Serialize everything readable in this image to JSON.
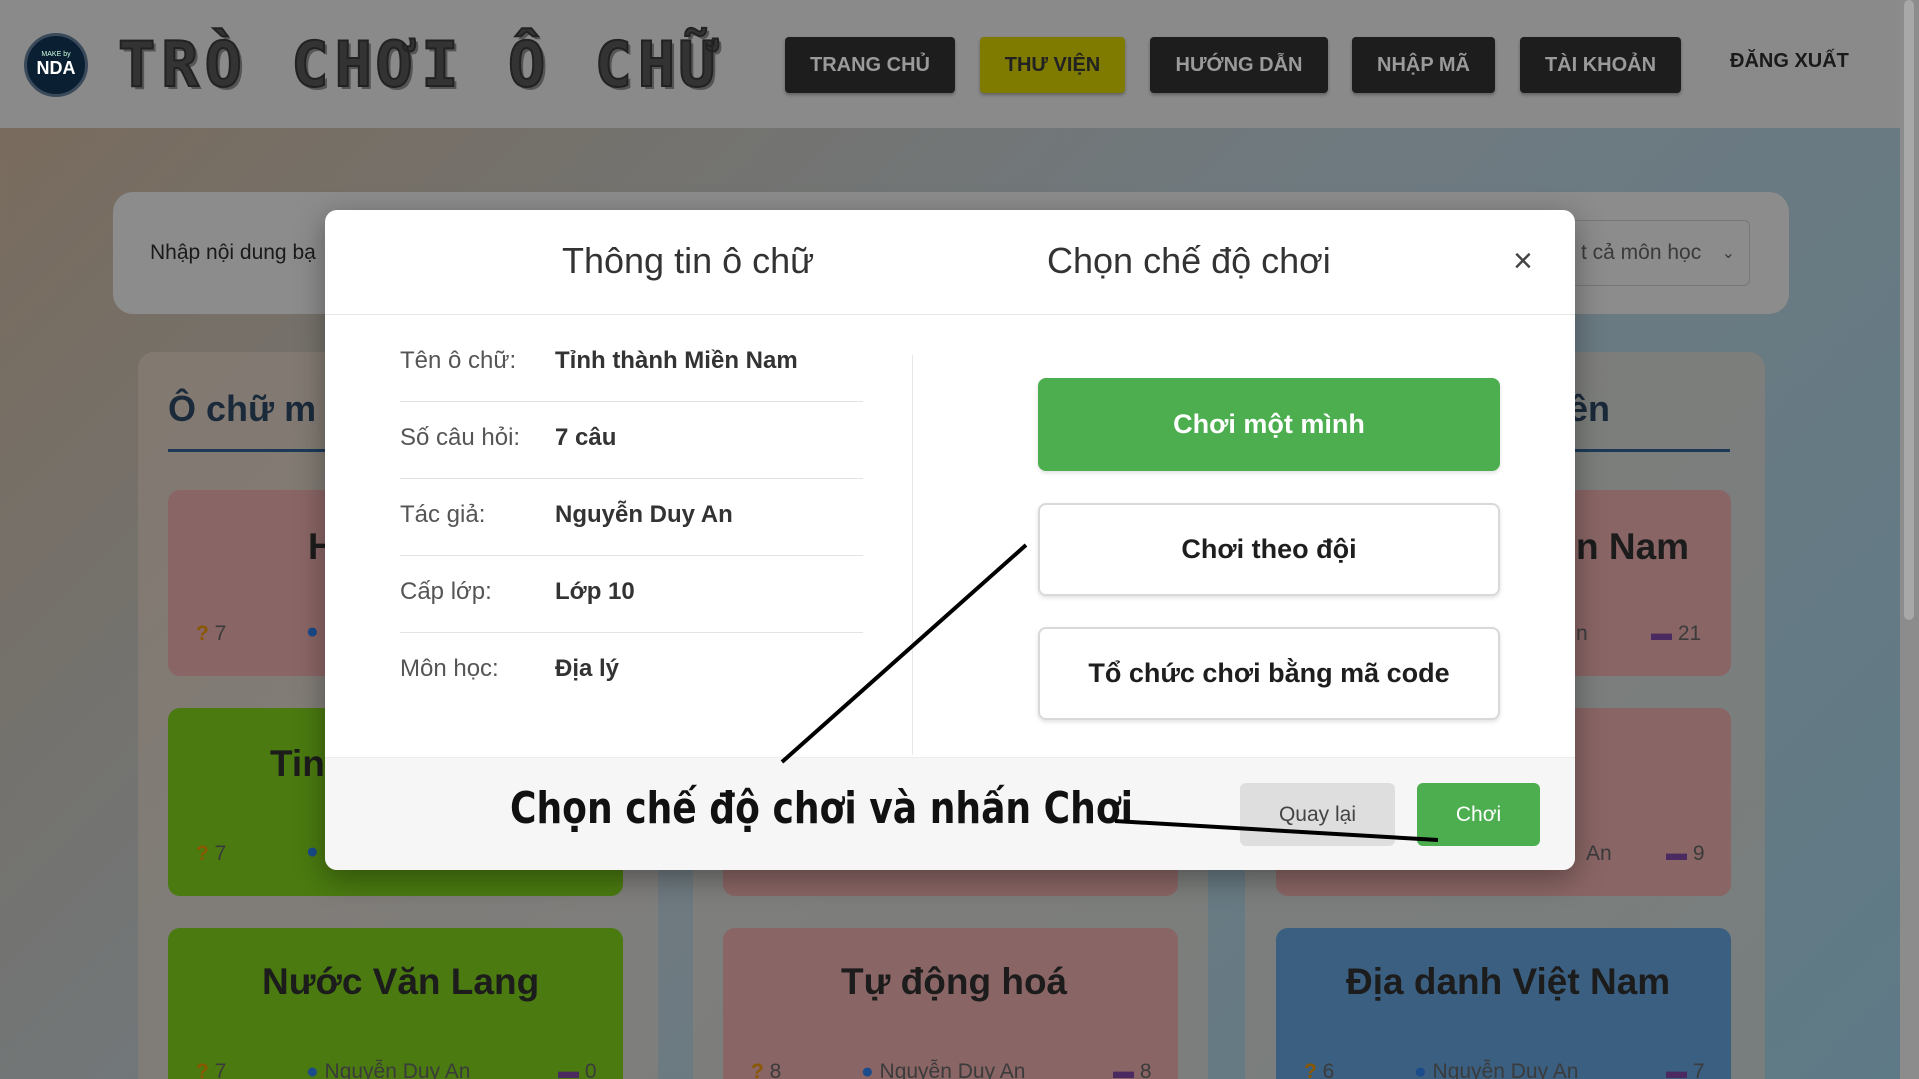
{
  "header": {
    "logo_small": "MAKE by",
    "logo_text": "NDA",
    "site_title": "TRÒ CHƠI Ô CHỮ",
    "nav": [
      "TRANG CHỦ",
      "THƯ VIỆN",
      "HƯỚNG DẪN",
      "NHẬP MÃ",
      "TÀI KHOẢN"
    ],
    "active_nav": "THƯ VIỆN",
    "logout": "ĐĂNG XUẤT"
  },
  "search": {
    "label": "Nhập nội dung bạ",
    "subject_select": "t cả môn học"
  },
  "sections": {
    "left_title": "Ô chữ m",
    "right_title": "ên"
  },
  "cards": [
    {
      "title": "H",
      "questions": "7",
      "author": "",
      "plays": ""
    },
    {
      "title": "n Nam",
      "questions": "",
      "author": "n",
      "plays": "21"
    },
    {
      "title": "Tin",
      "questions": "7",
      "author": "",
      "plays": ""
    },
    {
      "title": "",
      "questions": "",
      "author": "An",
      "plays": "9"
    },
    {
      "title": "Nước Văn Lang",
      "questions": "7",
      "author": "Nguyễn Duy An",
      "plays": "0"
    },
    {
      "title": "Tự động hoá",
      "questions": "8",
      "author": "Nguyễn Duy An",
      "plays": "8"
    },
    {
      "title": "Địa danh Việt Nam",
      "questions": "6",
      "author": "Nguyễn Duy An",
      "plays": "7"
    }
  ],
  "modal": {
    "title_info": "Thông tin ô chữ",
    "title_mode": "Chọn chế độ chơi",
    "close": "×",
    "info": [
      {
        "label": "Tên ô chữ:",
        "value": "Tỉnh thành Miền Nam"
      },
      {
        "label": "Số câu hỏi:",
        "value": "7 câu"
      },
      {
        "label": "Tác giả:",
        "value": "Nguyễn Duy An"
      },
      {
        "label": "Cấp lớp:",
        "value": "Lớp 10"
      },
      {
        "label": "Môn học:",
        "value": "Địa lý"
      }
    ],
    "modes": [
      "Chơi một mình",
      "Chơi theo đội",
      "Tổ chức chơi bằng mã code"
    ],
    "selected_mode": "Chơi một mình",
    "back_button": "Quay lại",
    "play_button": "Chơi",
    "annotation": "Chọn chế độ chơi và nhấn Chơi"
  }
}
